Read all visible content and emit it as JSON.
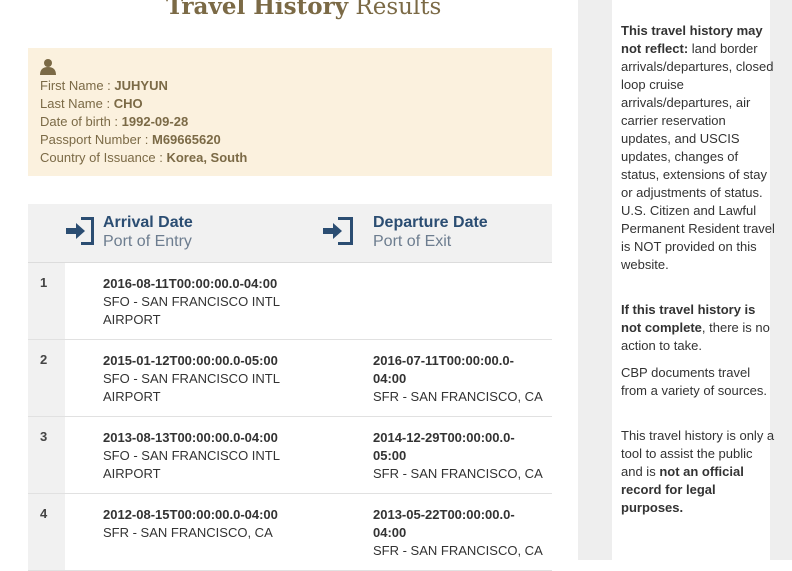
{
  "page": {
    "title_bold": "Travel History",
    "title_rest": "Results"
  },
  "traveler": {
    "first_name_label": "First Name :",
    "first_name": "JUHYUN",
    "last_name_label": "Last Name :",
    "last_name": "CHO",
    "dob_label": "Date of birth :",
    "dob": "1992-09-28",
    "passport_label": "Passport Number :",
    "passport": "M69665620",
    "country_label": "Country of Issuance :",
    "country": "Korea, South",
    "icon": "user-icon"
  },
  "table": {
    "arrival_title": "Arrival Date",
    "arrival_sub": "Port of Entry",
    "departure_title": "Departure Date",
    "departure_sub": "Port of Exit",
    "arrival_icon": "sign-in-icon",
    "departure_icon": "sign-out-icon",
    "rows": [
      {
        "index": "1",
        "arrival_date": "2016-08-11T00:00:00.0-04:00",
        "arrival_port": "SFO - SAN FRANCISCO INTL AIRPORT",
        "departure_date": "",
        "departure_port": ""
      },
      {
        "index": "2",
        "arrival_date": "2015-01-12T00:00:00.0-05:00",
        "arrival_port": "SFO - SAN FRANCISCO INTL AIRPORT",
        "departure_date": "2016-07-11T00:00:00.0-04:00",
        "departure_port": "SFR - SAN FRANCISCO, CA"
      },
      {
        "index": "3",
        "arrival_date": "2013-08-13T00:00:00.0-04:00",
        "arrival_port": "SFO - SAN FRANCISCO INTL AIRPORT",
        "departure_date": "2014-12-29T00:00:00.0-05:00",
        "departure_port": "SFR - SAN FRANCISCO, CA"
      },
      {
        "index": "4",
        "arrival_date": "2012-08-15T00:00:00.0-04:00",
        "arrival_port": "SFR - SAN FRANCISCO, CA",
        "departure_date": "2013-05-22T00:00:00.0-04:00",
        "departure_port": "SFR - SAN FRANCISCO, CA"
      }
    ]
  },
  "notice": {
    "p1_bold": "This travel history may not reflect:",
    "p1_rest": " land border arrivals/departures, closed loop cruise arrivals/departures, air carrier reservation updates, and USCIS updates, changes of status, extensions of stay or adjustments of status. U.S. Citizen and Lawful Permanent Resident travel is NOT provided on this website.",
    "p2_bold": "If this travel history is not complete",
    "p2_rest": ", there is no action to take.",
    "p3": "CBP documents travel from a variety of sources.",
    "p4_start": "This travel history is only a tool to assist the public and is ",
    "p4_bold": "not an official record for legal purposes."
  },
  "colors": {
    "title": "#7b6a46",
    "card_bg": "#fbf1de",
    "header_blue": "#2b4d72",
    "header_sub": "#6d7d8f"
  }
}
